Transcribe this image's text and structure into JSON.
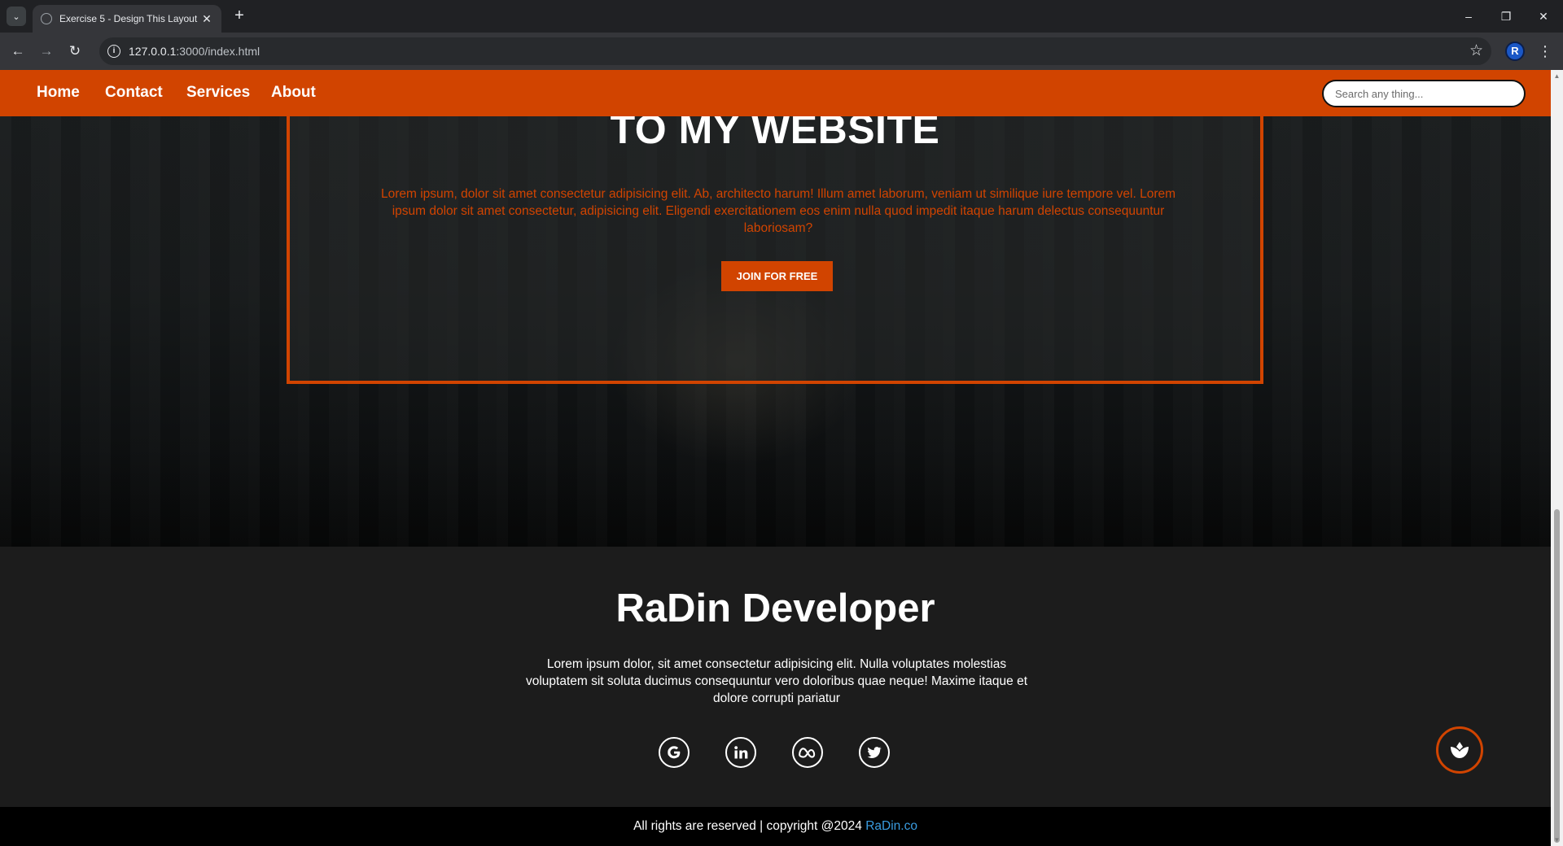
{
  "browser": {
    "tab_title": "Exercise 5 - Design This Layout",
    "url_host": "127.0.0.1",
    "url_path": ":3000/index.html",
    "profile_initial": "R"
  },
  "nav": {
    "links": [
      "Home",
      "Contact",
      "Services",
      "About"
    ],
    "search_placeholder": "Search any thing..."
  },
  "hero": {
    "heading": "TO MY WEBSITE",
    "paragraph": "Lorem ipsum, dolor sit amet consectetur adipisicing elit. Ab, architecto harum! Illum amet laborum, veniam ut similique iure tempore vel. Lorem ipsum dolor sit amet consectetur, adipisicing elit. Eligendi exercitationem eos enim nulla quod impedit itaque harum delectus consequuntur laboriosam?",
    "button_label": "JOIN FOR FREE"
  },
  "footer": {
    "title": "RaDin Developer",
    "paragraph": "Lorem ipsum dolor, sit amet consectetur adipisicing elit. Nulla voluptates molestias voluptatem sit soluta ducimus consequuntur vero doloribus quae neque! Maxime itaque et dolore corrupti pariatur",
    "social_icons": [
      "google-icon",
      "linkedin-icon",
      "meta-icon",
      "twitter-icon"
    ],
    "copyright_text": "All rights are reserved | copyright @2024 ",
    "copyright_link": "RaDin.co"
  },
  "colors": {
    "accent": "#d14400",
    "footer_bg": "#1c1c1c",
    "link": "#3a9ce0"
  }
}
